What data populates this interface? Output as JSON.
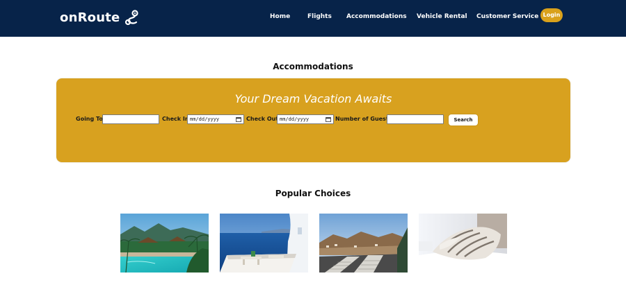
{
  "nav": {
    "brand": "onRoute",
    "links": [
      {
        "label": "Home"
      },
      {
        "label": "Flights"
      },
      {
        "label": "Accommodations"
      },
      {
        "label": "Vehicle Rental"
      },
      {
        "label": "Customer Service"
      }
    ],
    "login_label": "Login"
  },
  "page": {
    "title": "Accommodations",
    "popular_title": "Popular Choices"
  },
  "search": {
    "tagline": "Your Dream Vacation Awaits",
    "going_to_label": "Going To",
    "going_to_value": "",
    "check_in_label": "Check In",
    "check_in_placeholder": "mm/dd/yyyy",
    "check_out_label": "Check Out",
    "check_out_placeholder": "mm/dd/yyyy",
    "guests_label": "Number of Guests",
    "guests_value": "",
    "search_label": "Search"
  },
  "colors": {
    "nav_bg": "#072349",
    "accent": "#d8a11f",
    "text": "#111111"
  },
  "popular": [
    {
      "icon": "tropical-resort-photo"
    },
    {
      "icon": "santorini-terrace-photo"
    },
    {
      "icon": "mountain-town-lounge-photo"
    },
    {
      "icon": "bed-pillows-photo"
    }
  ]
}
